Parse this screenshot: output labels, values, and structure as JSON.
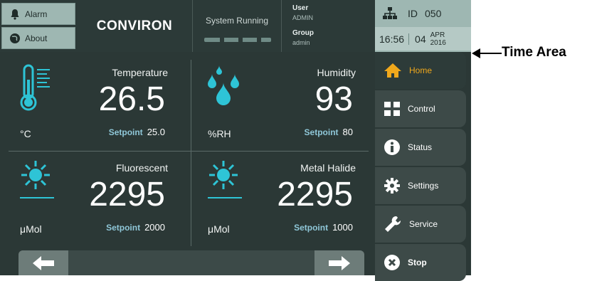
{
  "topbar": {
    "alarm_label": "Alarm",
    "about_label": "About",
    "brand": "CONVIRON",
    "system_status": "System Running",
    "user_key": "User",
    "user_value": "ADMIN",
    "group_key": "Group",
    "group_value": "admin",
    "id_label": "ID",
    "id_value": "050",
    "time": "16:56",
    "day": "04",
    "month": "APR",
    "year": "2016"
  },
  "tiles": [
    {
      "name": "Temperature",
      "value": "26.5",
      "unit": "°C",
      "setpoint_label": "Setpoint",
      "setpoint": "25.0",
      "icon": "thermometer-icon"
    },
    {
      "name": "Humidity",
      "value": "93",
      "unit": "%RH",
      "setpoint_label": "Setpoint",
      "setpoint": "80",
      "icon": "droplets-icon"
    },
    {
      "name": "Fluorescent",
      "value": "2295",
      "unit": "μMol",
      "setpoint_label": "Setpoint",
      "setpoint": "2000",
      "icon": "sun-icon"
    },
    {
      "name": "Metal Halide",
      "value": "2295",
      "unit": "μMol",
      "setpoint_label": "Setpoint",
      "setpoint": "1000",
      "icon": "sun-icon"
    }
  ],
  "nav": [
    {
      "label": "Home",
      "icon": "home-icon",
      "active": true
    },
    {
      "label": "Control",
      "icon": "control-icon"
    },
    {
      "label": "Status",
      "icon": "info-icon"
    },
    {
      "label": "Settings",
      "icon": "gear-icon"
    },
    {
      "label": "Service",
      "icon": "wrench-icon"
    },
    {
      "label": "Stop",
      "icon": "stop-icon"
    }
  ],
  "annotation": {
    "text": "Time Area"
  },
  "colors": {
    "accent_home": "#f0a81c",
    "sun": "#2ec4d6",
    "setpoint_label": "#8fc7d8",
    "panel": "#9eb7b2",
    "background": "#2b3836"
  }
}
